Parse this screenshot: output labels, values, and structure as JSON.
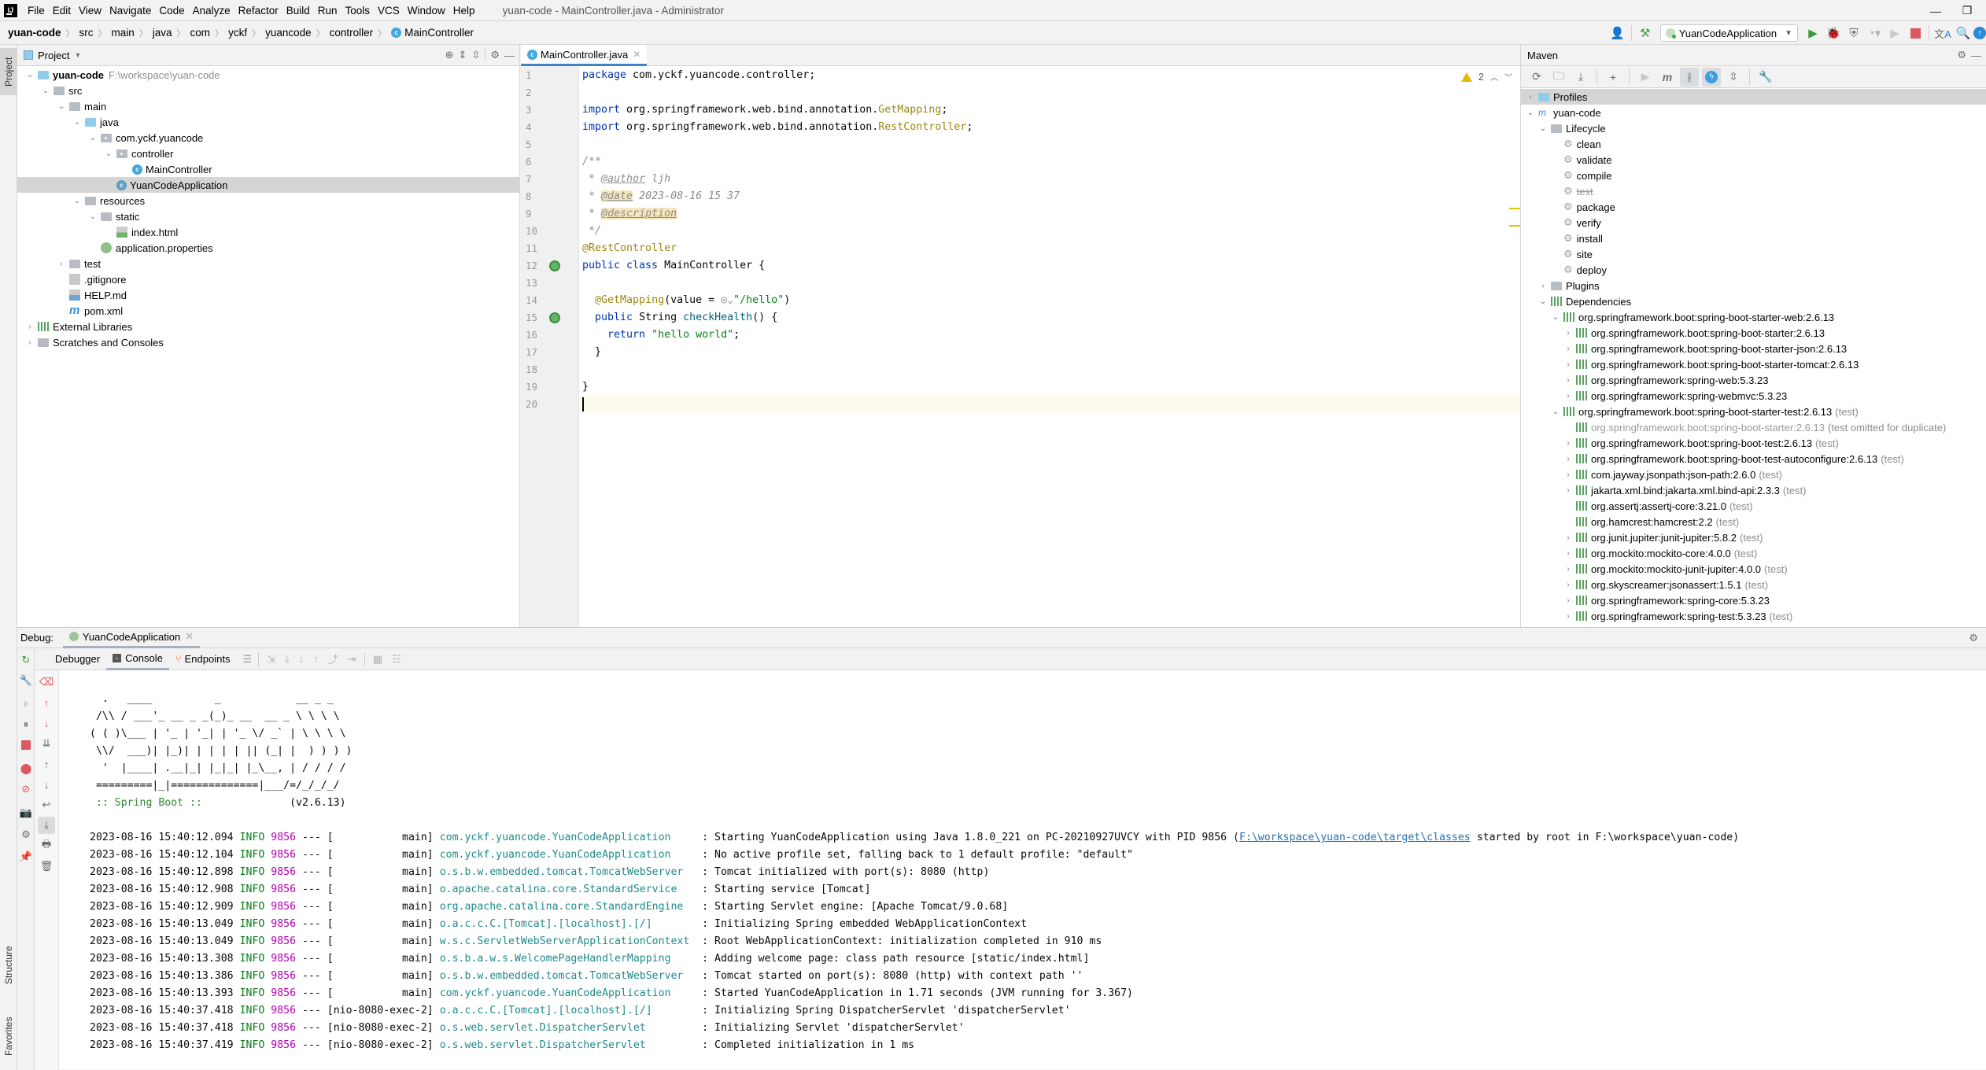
{
  "window": {
    "title": "yuan-code - MainController.java - Administrator",
    "menu": [
      "File",
      "Edit",
      "View",
      "Navigate",
      "Code",
      "Analyze",
      "Refactor",
      "Build",
      "Run",
      "Tools",
      "VCS",
      "Window",
      "Help"
    ],
    "minimize": "—",
    "restore": "❐"
  },
  "breadcrumb": [
    "yuan-code",
    "src",
    "main",
    "java",
    "com",
    "yckf",
    "yuancode",
    "controller",
    "MainController"
  ],
  "run_toolbar": {
    "config": "YuanCodeApplication"
  },
  "left_stripe": {
    "project": "Project",
    "structure": "Structure",
    "favorites": "Favorites"
  },
  "project_panel": {
    "title": "Project",
    "tree": [
      {
        "label": "yuan-code",
        "hint": "F:\\workspace\\yuan-code",
        "depth": 0,
        "arrow": "down",
        "icon": "module",
        "bold": true
      },
      {
        "label": "src",
        "depth": 1,
        "arrow": "down",
        "icon": "folder"
      },
      {
        "label": "main",
        "depth": 2,
        "arrow": "down",
        "icon": "folder"
      },
      {
        "label": "java",
        "depth": 3,
        "arrow": "down",
        "icon": "source-folder"
      },
      {
        "label": "com.yckf.yuancode",
        "depth": 4,
        "arrow": "down",
        "icon": "package"
      },
      {
        "label": "controller",
        "depth": 5,
        "arrow": "down",
        "icon": "package"
      },
      {
        "label": "MainController",
        "depth": 6,
        "arrow": "none",
        "icon": "class"
      },
      {
        "label": "YuanCodeApplication",
        "depth": 5,
        "arrow": "none",
        "icon": "spring-class",
        "selected": true
      },
      {
        "label": "resources",
        "depth": 3,
        "arrow": "down",
        "icon": "resources-folder"
      },
      {
        "label": "static",
        "depth": 4,
        "arrow": "down",
        "icon": "folder"
      },
      {
        "label": "index.html",
        "depth": 5,
        "arrow": "none",
        "icon": "html"
      },
      {
        "label": "application.properties",
        "depth": 4,
        "arrow": "none",
        "icon": "spring-props"
      },
      {
        "label": "test",
        "depth": 2,
        "arrow": "right",
        "icon": "folder"
      },
      {
        "label": ".gitignore",
        "depth": 2,
        "arrow": "none",
        "icon": "ignore"
      },
      {
        "label": "HELP.md",
        "depth": 2,
        "arrow": "none",
        "icon": "md"
      },
      {
        "label": "pom.xml",
        "depth": 2,
        "arrow": "none",
        "icon": "maven"
      },
      {
        "label": "External Libraries",
        "depth": 0,
        "arrow": "right",
        "icon": "libraries"
      },
      {
        "label": "Scratches and Consoles",
        "depth": 0,
        "arrow": "right",
        "icon": "scratches"
      }
    ]
  },
  "editor": {
    "tab": "MainController.java",
    "warnings": "2",
    "caret_line": 20,
    "lines": [
      [
        {
          "t": "package ",
          "c": "kw"
        },
        {
          "t": "com.yckf.yuancode.controller;"
        }
      ],
      [],
      [
        {
          "t": "import ",
          "c": "kw"
        },
        {
          "t": "org.springframework.web.bind.annotation."
        },
        {
          "t": "GetMapping",
          "c": "imp"
        },
        {
          "t": ";"
        }
      ],
      [
        {
          "t": "import ",
          "c": "kw"
        },
        {
          "t": "org.springframework.web.bind.annotation."
        },
        {
          "t": "RestController",
          "c": "imp"
        },
        {
          "t": ";"
        }
      ],
      [],
      [
        {
          "t": "/**",
          "c": "cm"
        }
      ],
      [
        {
          "t": " * ",
          "c": "cm"
        },
        {
          "t": "@author",
          "c": "tag"
        },
        {
          "t": " ljh",
          "c": "cm"
        }
      ],
      [
        {
          "t": " * ",
          "c": "cm"
        },
        {
          "t": "@date",
          "c": "tag hl"
        },
        {
          "t": " 2023-08-16 15 37",
          "c": "cm"
        }
      ],
      [
        {
          "t": " * ",
          "c": "cm"
        },
        {
          "t": "@description",
          "c": "tag hl"
        }
      ],
      [
        {
          "t": " */",
          "c": "cm"
        }
      ],
      [
        {
          "t": "@RestController",
          "c": "ann"
        }
      ],
      [
        {
          "t": "public class ",
          "c": "kw"
        },
        {
          "t": "MainController {"
        }
      ],
      [],
      [
        {
          "t": "  "
        },
        {
          "t": "@GetMapping",
          "c": "ann"
        },
        {
          "t": "(value = "
        },
        {
          "t": "◎⌄",
          "c": "cm"
        },
        {
          "t": "\"/hello\"",
          "c": "str"
        },
        {
          "t": ")"
        }
      ],
      [
        {
          "t": "  "
        },
        {
          "t": "public ",
          "c": "kw"
        },
        {
          "t": "String "
        },
        {
          "t": "checkHealth",
          "c": "fn"
        },
        {
          "t": "() {"
        }
      ],
      [
        {
          "t": "    "
        },
        {
          "t": "return ",
          "c": "kw"
        },
        {
          "t": "\"hello world\"",
          "c": "str"
        },
        {
          "t": ";"
        }
      ],
      [
        {
          "t": "  }"
        }
      ],
      [],
      [
        {
          "t": "}"
        }
      ],
      []
    ]
  },
  "maven": {
    "title": "Maven",
    "tree": [
      {
        "label": "Profiles",
        "depth": 0,
        "arrow": "right",
        "icon": "profiles",
        "selected": true
      },
      {
        "label": "yuan-code",
        "depth": 0,
        "arrow": "down",
        "icon": "maven-module"
      },
      {
        "label": "Lifecycle",
        "depth": 1,
        "arrow": "down",
        "icon": "lifecycle"
      },
      {
        "label": "clean",
        "depth": 2,
        "arrow": "none",
        "icon": "gear"
      },
      {
        "label": "validate",
        "depth": 2,
        "arrow": "none",
        "icon": "gear"
      },
      {
        "label": "compile",
        "depth": 2,
        "arrow": "none",
        "icon": "gear"
      },
      {
        "label": "test",
        "depth": 2,
        "arrow": "none",
        "icon": "gear",
        "skipped": true
      },
      {
        "label": "package",
        "depth": 2,
        "arrow": "none",
        "icon": "gear"
      },
      {
        "label": "verify",
        "depth": 2,
        "arrow": "none",
        "icon": "gear"
      },
      {
        "label": "install",
        "depth": 2,
        "arrow": "none",
        "icon": "gear"
      },
      {
        "label": "site",
        "depth": 2,
        "arrow": "none",
        "icon": "gear"
      },
      {
        "label": "deploy",
        "depth": 2,
        "arrow": "none",
        "icon": "gear"
      },
      {
        "label": "Plugins",
        "depth": 1,
        "arrow": "right",
        "icon": "plugins"
      },
      {
        "label": "Dependencies",
        "depth": 1,
        "arrow": "down",
        "icon": "dependencies"
      },
      {
        "label": "org.springframework.boot:spring-boot-starter-web:2.6.13",
        "depth": 2,
        "arrow": "down",
        "icon": "lib"
      },
      {
        "label": "org.springframework.boot:spring-boot-starter:2.6.13",
        "depth": 3,
        "arrow": "right",
        "icon": "lib"
      },
      {
        "label": "org.springframework.boot:spring-boot-starter-json:2.6.13",
        "depth": 3,
        "arrow": "right",
        "icon": "lib"
      },
      {
        "label": "org.springframework.boot:spring-boot-starter-tomcat:2.6.13",
        "depth": 3,
        "arrow": "right",
        "icon": "lib"
      },
      {
        "label": "org.springframework:spring-web:5.3.23",
        "depth": 3,
        "arrow": "right",
        "icon": "lib"
      },
      {
        "label": "org.springframework:spring-webmvc:5.3.23",
        "depth": 3,
        "arrow": "right",
        "icon": "lib"
      },
      {
        "label": "org.springframework.boot:spring-boot-starter-test:2.6.13",
        "hint": "(test)",
        "depth": 2,
        "arrow": "down",
        "icon": "lib"
      },
      {
        "label": "org.springframework.boot:spring-boot-starter:2.6.13",
        "hint": "(test omitted for duplicate)",
        "depth": 3,
        "arrow": "none",
        "icon": "lib",
        "dimmed": true
      },
      {
        "label": "org.springframework.boot:spring-boot-test:2.6.13",
        "hint": "(test)",
        "depth": 3,
        "arrow": "right",
        "icon": "lib"
      },
      {
        "label": "org.springframework.boot:spring-boot-test-autoconfigure:2.6.13",
        "hint": "(test)",
        "depth": 3,
        "arrow": "right",
        "icon": "lib"
      },
      {
        "label": "com.jayway.jsonpath:json-path:2.6.0",
        "hint": "(test)",
        "depth": 3,
        "arrow": "right",
        "icon": "lib"
      },
      {
        "label": "jakarta.xml.bind:jakarta.xml.bind-api:2.3.3",
        "hint": "(test)",
        "depth": 3,
        "arrow": "right",
        "icon": "lib"
      },
      {
        "label": "org.assertj:assertj-core:3.21.0",
        "hint": "(test)",
        "depth": 3,
        "arrow": "none",
        "icon": "lib"
      },
      {
        "label": "org.hamcrest:hamcrest:2.2",
        "hint": "(test)",
        "depth": 3,
        "arrow": "none",
        "icon": "lib"
      },
      {
        "label": "org.junit.jupiter:junit-jupiter:5.8.2",
        "hint": "(test)",
        "depth": 3,
        "arrow": "right",
        "icon": "lib"
      },
      {
        "label": "org.mockito:mockito-core:4.0.0",
        "hint": "(test)",
        "depth": 3,
        "arrow": "right",
        "icon": "lib"
      },
      {
        "label": "org.mockito:mockito-junit-jupiter:4.0.0",
        "hint": "(test)",
        "depth": 3,
        "arrow": "right",
        "icon": "lib"
      },
      {
        "label": "org.skyscreamer:jsonassert:1.5.1",
        "hint": "(test)",
        "depth": 3,
        "arrow": "right",
        "icon": "lib"
      },
      {
        "label": "org.springframework:spring-core:5.3.23",
        "depth": 3,
        "arrow": "right",
        "icon": "lib"
      },
      {
        "label": "org.springframework:spring-test:5.3.23",
        "hint": "(test)",
        "depth": 3,
        "arrow": "right",
        "icon": "lib"
      }
    ]
  },
  "debug": {
    "label": "Debug:",
    "session_tab": "YuanCodeApplication",
    "subtabs": [
      "Debugger",
      "Console",
      "Endpoints"
    ],
    "active_subtab": "Console",
    "banner": [
      "  .   ____          _            __ _ _",
      " /\\\\ / ___'_ __ _ _(_)_ __  __ _ \\ \\ \\ \\",
      "( ( )\\___ | '_ | '_| | '_ \\/ _` | \\ \\ \\ \\",
      " \\\\/  ___)| |_)| | | | | || (_| |  ) ) ) )",
      "  '  |____| .__|_| |_|_| |_\\__, | / / / /",
      " =========|_|==============|___/=/_/_/_/"
    ],
    "boot_label": " :: Spring Boot ::",
    "boot_version": "(v2.6.13)",
    "logs": [
      {
        "ts": "2023-08-16 15:40:12.094",
        "level": "INFO",
        "pid": "9856",
        "thread": "           main",
        "logger": "com.yckf.yuancode.YuanCodeApplication    ",
        "msg": ": Starting YuanCodeApplication using Java 1.8.0_221 on PC-20210927UVCY with PID 9856 (",
        "link": "F:\\workspace\\yuan-code\\target\\classes",
        "tail": " started by root in F:\\workspace\\yuan-code)"
      },
      {
        "ts": "2023-08-16 15:40:12.104",
        "level": "INFO",
        "pid": "9856",
        "thread": "           main",
        "logger": "com.yckf.yuancode.YuanCodeApplication    ",
        "msg": ": No active profile set, falling back to 1 default profile: \"default\""
      },
      {
        "ts": "2023-08-16 15:40:12.898",
        "level": "INFO",
        "pid": "9856",
        "thread": "           main",
        "logger": "o.s.b.w.embedded.tomcat.TomcatWebServer  ",
        "msg": ": Tomcat initialized with port(s): 8080 (http)"
      },
      {
        "ts": "2023-08-16 15:40:12.908",
        "level": "INFO",
        "pid": "9856",
        "thread": "           main",
        "logger": "o.apache.catalina.core.StandardService   ",
        "msg": ": Starting service [Tomcat]"
      },
      {
        "ts": "2023-08-16 15:40:12.909",
        "level": "INFO",
        "pid": "9856",
        "thread": "           main",
        "logger": "org.apache.catalina.core.StandardEngine  ",
        "msg": ": Starting Servlet engine: [Apache Tomcat/9.0.68]"
      },
      {
        "ts": "2023-08-16 15:40:13.049",
        "level": "INFO",
        "pid": "9856",
        "thread": "           main",
        "logger": "o.a.c.c.C.[Tomcat].[localhost].[/]       ",
        "msg": ": Initializing Spring embedded WebApplicationContext"
      },
      {
        "ts": "2023-08-16 15:40:13.049",
        "level": "INFO",
        "pid": "9856",
        "thread": "           main",
        "logger": "w.s.c.ServletWebServerApplicationContext ",
        "msg": ": Root WebApplicationContext: initialization completed in 910 ms"
      },
      {
        "ts": "2023-08-16 15:40:13.308",
        "level": "INFO",
        "pid": "9856",
        "thread": "           main",
        "logger": "o.s.b.a.w.s.WelcomePageHandlerMapping    ",
        "msg": ": Adding welcome page: class path resource [static/index.html]"
      },
      {
        "ts": "2023-08-16 15:40:13.386",
        "level": "INFO",
        "pid": "9856",
        "thread": "           main",
        "logger": "o.s.b.w.embedded.tomcat.TomcatWebServer  ",
        "msg": ": Tomcat started on port(s): 8080 (http) with context path ''"
      },
      {
        "ts": "2023-08-16 15:40:13.393",
        "level": "INFO",
        "pid": "9856",
        "thread": "           main",
        "logger": "com.yckf.yuancode.YuanCodeApplication    ",
        "msg": ": Started YuanCodeApplication in 1.71 seconds (JVM running for 3.367)"
      },
      {
        "ts": "2023-08-16 15:40:37.418",
        "level": "INFO",
        "pid": "9856",
        "thread": "nio-8080-exec-2",
        "logger": "o.a.c.c.C.[Tomcat].[localhost].[/]       ",
        "msg": ": Initializing Spring DispatcherServlet 'dispatcherServlet'"
      },
      {
        "ts": "2023-08-16 15:40:37.418",
        "level": "INFO",
        "pid": "9856",
        "thread": "nio-8080-exec-2",
        "logger": "o.s.web.servlet.DispatcherServlet        ",
        "msg": ": Initializing Servlet 'dispatcherServlet'"
      },
      {
        "ts": "2023-08-16 15:40:37.419",
        "level": "INFO",
        "pid": "9856",
        "thread": "nio-8080-exec-2",
        "logger": "o.s.web.servlet.DispatcherServlet        ",
        "msg": ": Completed initialization in 1 ms"
      }
    ]
  },
  "colors": {
    "accent": "#4083c9",
    "selection": "#d5d5d5",
    "run_green": "#3c9a3c",
    "stop_red": "#db5860",
    "warning": "#e8b800"
  }
}
